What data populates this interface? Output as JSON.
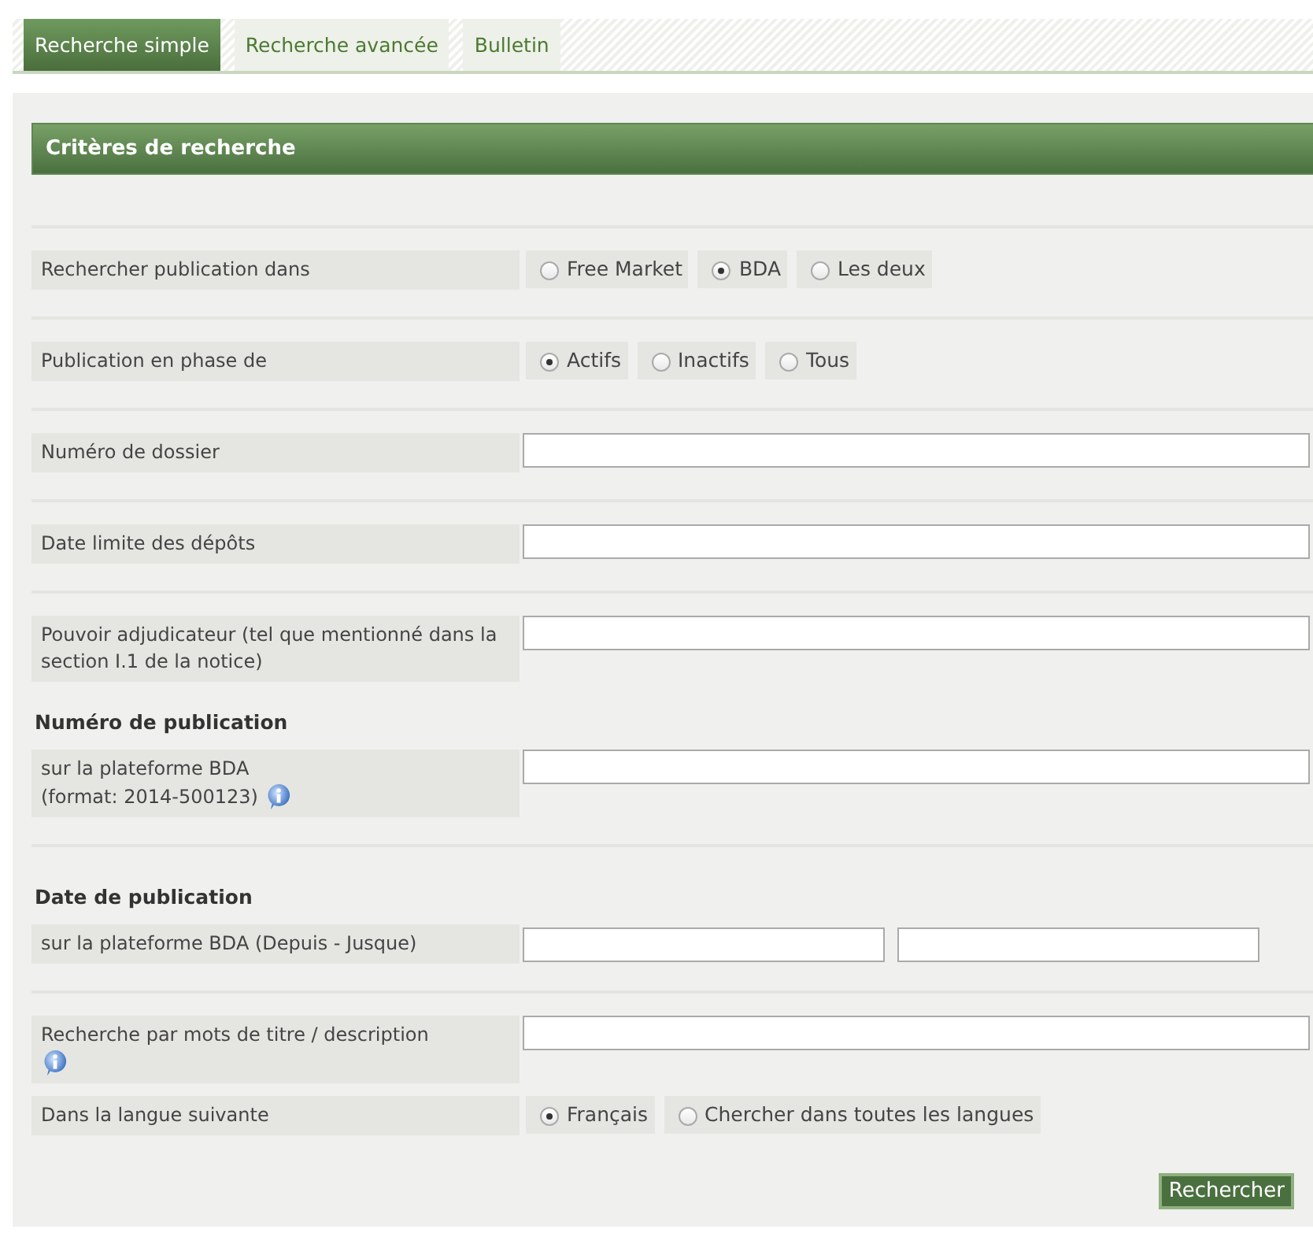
{
  "tabs": [
    {
      "label": "Recherche simple",
      "selected": true
    },
    {
      "label": "Recherche avancée",
      "selected": false
    },
    {
      "label": "Bulletin",
      "selected": false
    }
  ],
  "panel": {
    "title": "Critères de recherche",
    "groups": [
      [
        {
          "kind": "radio",
          "label": "Rechercher publication dans",
          "options": [
            {
              "label": "Free Market",
              "selected": false
            },
            {
              "label": "BDA",
              "selected": true
            },
            {
              "label": "Les deux",
              "selected": false
            }
          ]
        }
      ],
      [
        {
          "kind": "radio",
          "label": "Publication en phase de",
          "options": [
            {
              "label": "Actifs",
              "selected": true
            },
            {
              "label": "Inactifs",
              "selected": false
            },
            {
              "label": "Tous",
              "selected": false
            }
          ]
        }
      ],
      [
        {
          "kind": "field",
          "label": "Numéro de dossier",
          "info": false
        }
      ],
      [
        {
          "kind": "field",
          "label": "Date limite des dépôts",
          "info": false
        }
      ],
      [
        {
          "kind": "field",
          "label": "Pouvoir adjudicateur (tel que mentionné dans la section I.1 de la notice)",
          "info": false
        },
        {
          "kind": "heading",
          "label": "Numéro de publication"
        },
        {
          "kind": "field",
          "label": "sur la plateforme BDA",
          "hint": "(format: 2014-500123)",
          "info": true
        }
      ],
      [
        {
          "kind": "heading",
          "label": "Date de publication"
        },
        {
          "kind": "range",
          "label": "sur la plateforme BDA (Depuis - Jusque)"
        }
      ],
      [
        {
          "kind": "field",
          "label": "Recherche par mots de titre / description",
          "info": true
        },
        {
          "kind": "radio",
          "label": "Dans la langue suivante",
          "options": [
            {
              "label": "Français",
              "selected": true
            },
            {
              "label": "Chercher dans toutes les langues",
              "selected": false
            }
          ]
        }
      ]
    ],
    "submit": "Rechercher"
  }
}
